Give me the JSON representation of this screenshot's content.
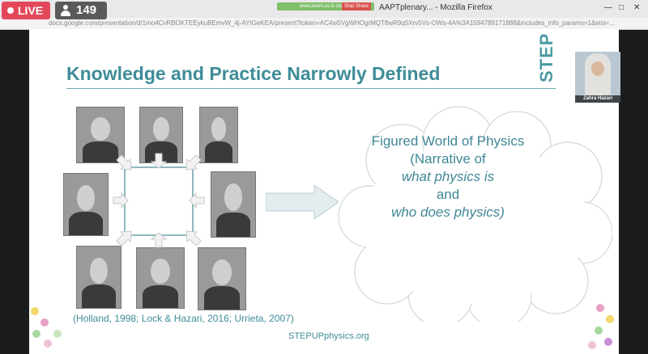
{
  "stream": {
    "live_label": "LIVE",
    "viewer_count": "149",
    "live_color": "#e3485a"
  },
  "window": {
    "title": "AAPTplenary... - Mozilla Firefox",
    "sharing_label": "www.zoom.us is sharing",
    "stop_share_label": "Stop Share",
    "url": "docs.google.com/presentation/d/1mo4CvRBOKTEEykuBEmvW_4j-AYtGeKEA/present?token=AC4w5VgWHOgrMQT8wR9q5Xrv5Vs-OWs-4A%3A1594789171888&includes_info_params=1&eisi=..."
  },
  "slide": {
    "title": "Knowledge and Practice Narrowly Defined",
    "brand_vertical": "STEP UP",
    "cloud_lines": [
      "Figured World of Physics",
      "(Narrative of",
      "what physics is",
      "and",
      "who does physics)"
    ],
    "citation": "(Holland, 1998; Lock & Hazari, 2016; Urrieta, 2007)",
    "site": "STEPUPphysics.org",
    "accent_color": "#3e8c97"
  },
  "webcam": {
    "presenter_name": "Zahra Hazari"
  }
}
